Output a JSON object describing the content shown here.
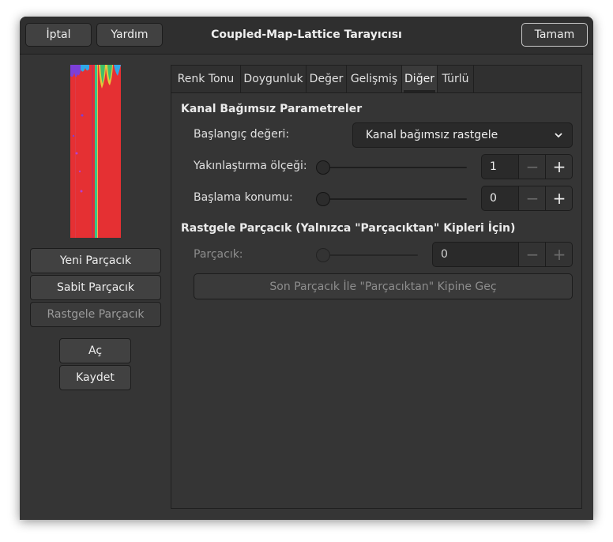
{
  "window": {
    "title": "Coupled-Map-Lattice Tarayıcısı",
    "cancel_label": "İptal",
    "help_label": "Yardım",
    "ok_label": "Tamam"
  },
  "left": {
    "new_seed": "Yeni Parçacık",
    "fixed_seed": "Sabit Parçacık",
    "random_seed": "Rastgele Parçacık",
    "open": "Aç",
    "save": "Kaydet"
  },
  "tabs": [
    "Renk Tonu",
    "Doygunluk",
    "Değer",
    "Gelişmiş",
    "Diğer",
    "Türlü"
  ],
  "active_tab": "Diğer",
  "channel_independent": {
    "heading": "Kanal Bağımsız Parametreler",
    "initial_value_label": "Başlangıç değeri:",
    "initial_value_selected": "Kanal bağımsız rastgele",
    "zoom_label": "Yakınlaştırma ölçeği:",
    "zoom_value": "1",
    "start_label": "Başlama konumu:",
    "start_value": "0"
  },
  "random_seed": {
    "heading": "Rastgele Parçacık (Yalnızca \"Parçacıktan\" Kipleri İçin)",
    "seed_label": "Parçacık:",
    "seed_value": "0",
    "switch_button": "Son Parçacık İle \"Parçacıktan\" Kipine Geç"
  },
  "icons": {
    "dropdown": "chevron-down-icon",
    "minus": "minus-icon",
    "plus": "plus-icon"
  },
  "colors": {
    "preview_base": "#e53033"
  }
}
